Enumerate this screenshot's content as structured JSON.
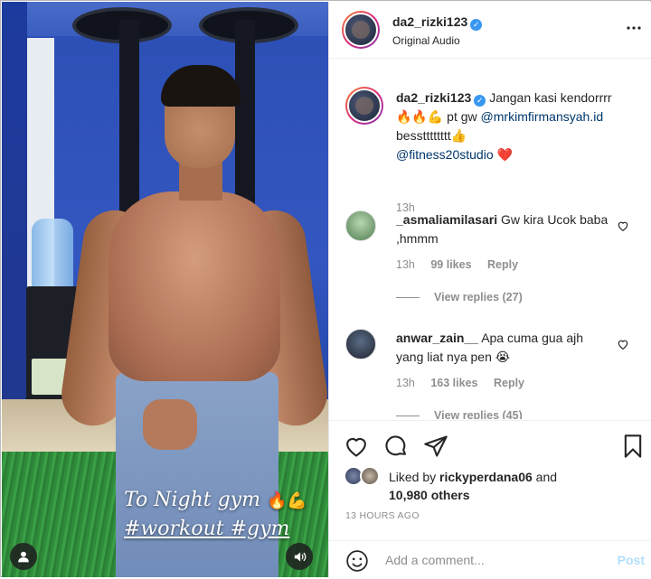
{
  "post": {
    "username": "da2_rizki123",
    "subtitle": "Original Audio"
  },
  "media": {
    "caption_line1": "To Night gym",
    "caption_line1_emoji": "🔥💪",
    "caption_line2": "#workout #gym"
  },
  "author_comment": {
    "username": "da2_rizki123",
    "text_part1": "Jangan kasi kendorrrr",
    "emoji_line": "🔥🔥💪 pt gw",
    "mention1": "@mrkimfirmansyah.id",
    "text_part2": "besstttttttt👍",
    "mention2": "@fitness20studio",
    "heart": "❤️",
    "time": "13h"
  },
  "comments": [
    {
      "username": "_asmaliamilasari",
      "text": "Gw kira Ucok baba ,hmmm",
      "time": "13h",
      "likes": "99 likes",
      "reply": "Reply",
      "view_replies": "View replies (27)"
    },
    {
      "username": "anwar_zain__",
      "text": "Apa cuma gua ajh yang liat nya pen 😭",
      "time": "13h",
      "likes": "163 likes",
      "reply": "Reply",
      "view_replies": "View replies (45)"
    }
  ],
  "likes": {
    "prefix": "Liked by ",
    "user": "rickyperdana06",
    "and": " and",
    "others": "10,980 others"
  },
  "timestamp": "13 HOURS AGO",
  "add_comment": {
    "placeholder": "Add a comment...",
    "post_label": "Post"
  },
  "icons": {
    "more": "more-icon",
    "like": "heart-icon",
    "comment": "comment-icon",
    "share": "share-icon",
    "save": "bookmark-icon",
    "emoji": "emoji-icon",
    "tag": "user-tag-icon",
    "audio": "speaker-icon"
  },
  "colors": {
    "verified": "#3897f0",
    "link": "#00376b",
    "muted": "#8e8e8e",
    "post_disabled": "#b2dffc"
  }
}
